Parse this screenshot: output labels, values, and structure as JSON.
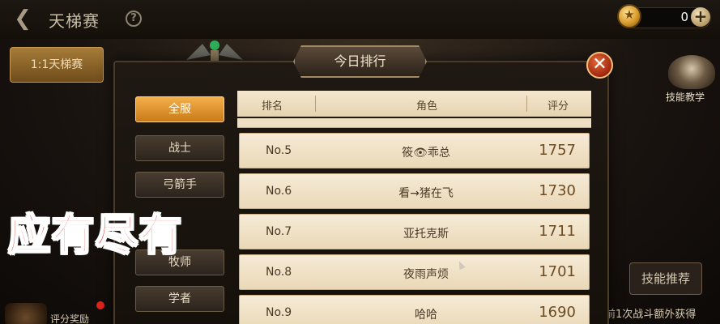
{
  "topbar": {
    "back_icon": "back-arrow-icon",
    "title": "天梯赛",
    "help_icon": "question-icon",
    "currency_value": "0",
    "plus_icon": "plus-icon",
    "medal_icon": "medal-icon"
  },
  "left_tab": {
    "label": "1:1天梯赛"
  },
  "modal": {
    "title": "今日排行",
    "close_icon": "close-icon",
    "filters": [
      "全服",
      "战士",
      "弓箭手",
      "牧师",
      "学者"
    ],
    "active_filter": "全服",
    "columns": {
      "rank": "排名",
      "role": "角色",
      "score": "评分"
    },
    "rows": [
      {
        "rank": "No.5",
        "name": "筱👁乖总",
        "score": "1757"
      },
      {
        "rank": "No.6",
        "name": "看→猪在飞",
        "score": "1730"
      },
      {
        "rank": "No.7",
        "name": "亚托克斯",
        "score": "1711"
      },
      {
        "rank": "No.8",
        "name": "夜雨声烦",
        "score": "1701"
      },
      {
        "rank": "No.9",
        "name": "哈哈",
        "score": "1690"
      }
    ]
  },
  "right_panel": {
    "mentor_label": "技能教学",
    "skill_recommend": "技能推荐",
    "bonus_text": "前1次战斗额外获得"
  },
  "bottom_left": {
    "reward_label": "评分奖励"
  },
  "overlay_caption": "应有尽有",
  "colors": {
    "accent": "#e8a23a",
    "caption": "#e8120a"
  }
}
